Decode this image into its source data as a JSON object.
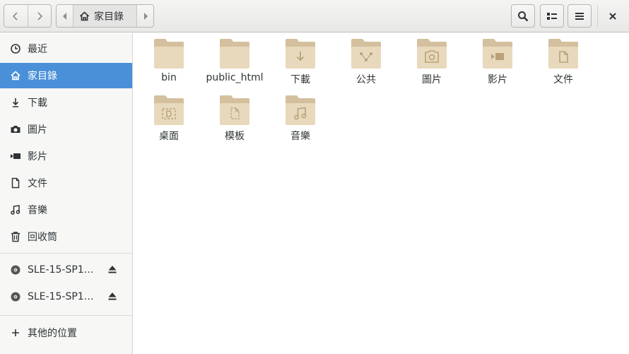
{
  "header": {
    "breadcrumb": "家目錄",
    "icons": {
      "back": "chevron-left-icon",
      "forward": "chevron-right-icon",
      "home": "home-icon",
      "search": "search-icon",
      "view": "list-view-icon",
      "menu": "hamburger-menu-icon",
      "close": "close-icon"
    }
  },
  "sidebar": {
    "places": [
      {
        "label": "最近",
        "icon": "recent-clock-icon"
      },
      {
        "label": "家目錄",
        "icon": "home-icon",
        "active": true
      },
      {
        "label": "下載",
        "icon": "download-icon"
      },
      {
        "label": "圖片",
        "icon": "camera-icon"
      },
      {
        "label": "影片",
        "icon": "video-icon"
      },
      {
        "label": "文件",
        "icon": "document-icon"
      },
      {
        "label": "音樂",
        "icon": "music-icon"
      },
      {
        "label": "回收筒",
        "icon": "trash-icon"
      }
    ],
    "devices": [
      {
        "label": "SLE-15-SP1…",
        "icon": "disc-icon"
      },
      {
        "label": "SLE-15-SP1…",
        "icon": "disc-icon"
      }
    ],
    "other": {
      "label": "其他的位置",
      "icon": "plus-icon"
    }
  },
  "files": [
    {
      "name": "bin",
      "emblem": "none"
    },
    {
      "name": "public_html",
      "emblem": "none"
    },
    {
      "name": "下載",
      "emblem": "download"
    },
    {
      "name": "公共",
      "emblem": "share"
    },
    {
      "name": "圖片",
      "emblem": "camera"
    },
    {
      "name": "影片",
      "emblem": "video"
    },
    {
      "name": "文件",
      "emblem": "document"
    },
    {
      "name": "桌面",
      "emblem": "desktop"
    },
    {
      "name": "模板",
      "emblem": "template"
    },
    {
      "name": "音樂",
      "emblem": "music"
    }
  ],
  "colors": {
    "accent": "#4a90d9",
    "folder": "#e8d9bc",
    "folder_back": "#d4c09e"
  }
}
